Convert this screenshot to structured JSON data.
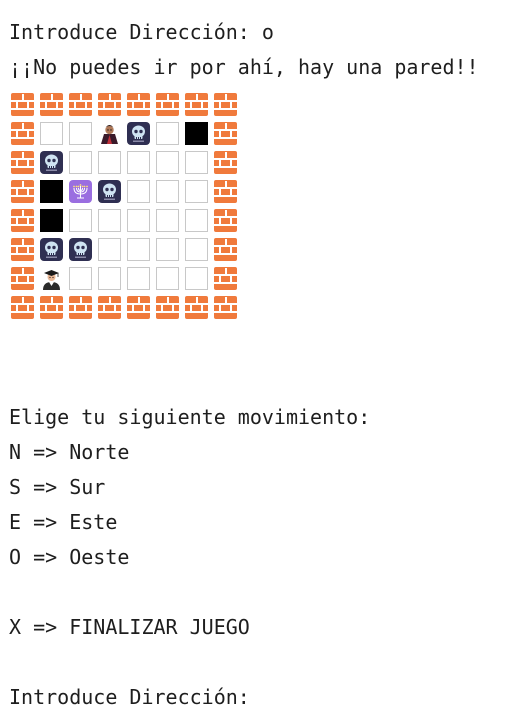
{
  "console": {
    "lines": [
      "Introduce Dirección: o",
      "¡¡No puedes ir por ahí, hay una pared!!",
      "Elige tu siguiente movimiento:",
      "N => Norte",
      "S => Sur",
      "E => Este",
      "O => Oeste",
      "X => FINALIZAR JUEGO",
      "Introduce Dirección:"
    ]
  },
  "maze": {
    "legend": {
      "W": "brick-wall-icon",
      "_": "empty-square",
      "B": "black-square",
      "S": "skull-icon",
      "V": "vampire-icon",
      "M": "menorah-icon",
      "P": "student-icon"
    },
    "rows": [
      "WWWWWWWW",
      "W__VS_BW",
      "WS_____W",
      "WBMS___W",
      "WB_____W",
      "WSS____W",
      "WP_____W",
      "WWWWWWWW"
    ]
  }
}
